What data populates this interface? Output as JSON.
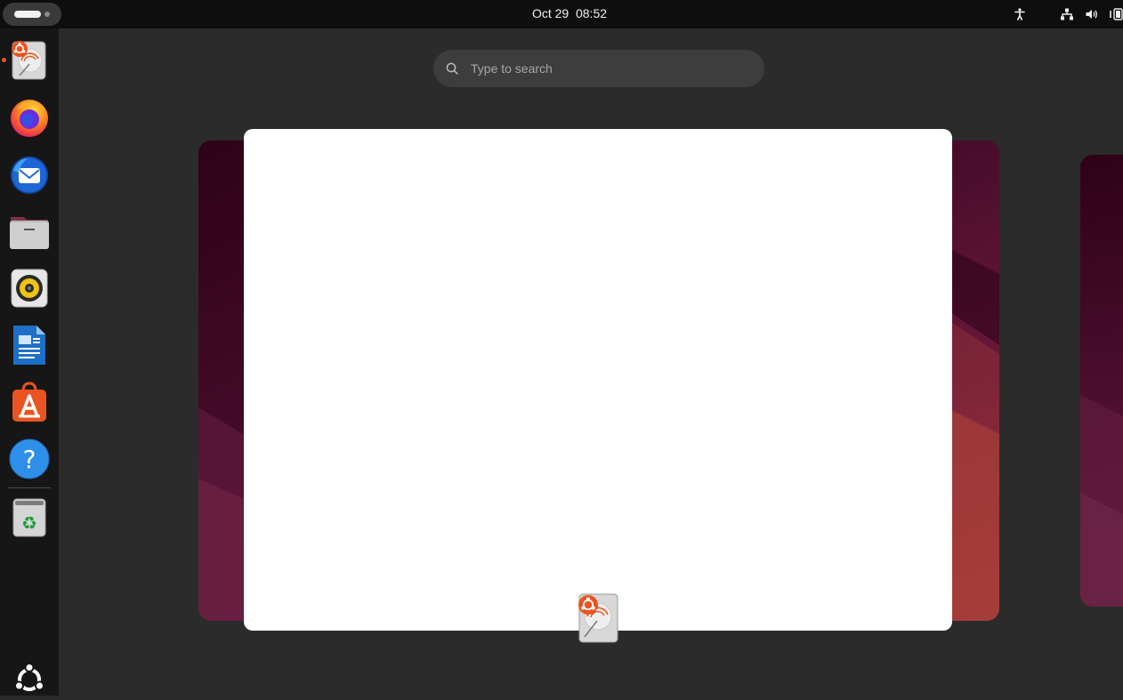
{
  "topbar": {
    "date": "Oct 29",
    "time": "08:52",
    "tray_icons": [
      "accessibility-icon",
      "network-icon",
      "volume-icon",
      "battery-icon"
    ]
  },
  "dock": {
    "apps": [
      {
        "name": "ubuntu-installer",
        "icon": "installer-icon",
        "running": true
      },
      {
        "name": "firefox",
        "icon": "firefox-icon"
      },
      {
        "name": "thunderbird",
        "icon": "thunderbird-icon"
      },
      {
        "name": "files",
        "icon": "files-icon"
      },
      {
        "name": "rhythmbox",
        "icon": "rhythmbox-icon"
      },
      {
        "name": "libreoffice-writer",
        "icon": "writer-icon"
      },
      {
        "name": "app-center",
        "icon": "app-center-icon"
      },
      {
        "name": "help",
        "icon": "help-icon"
      },
      {
        "name": "trash",
        "icon": "trash-icon"
      }
    ],
    "show_apps_icon": "ubuntu-logo-icon"
  },
  "search": {
    "placeholder": "Type to search"
  },
  "colors": {
    "accent": "#e95420",
    "background": "#2b2b2b",
    "dock": "#161616",
    "topbar": "#0e0e0e"
  }
}
